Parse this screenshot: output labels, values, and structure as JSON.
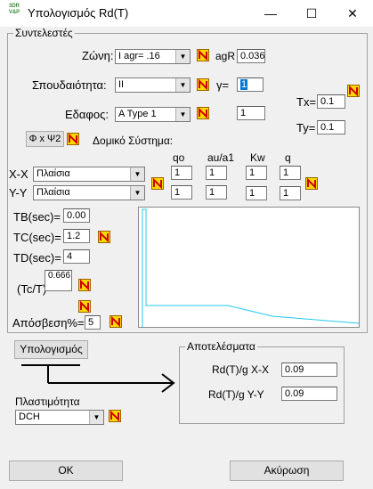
{
  "window": {
    "title": "Υπολογισμός Rd(T)",
    "app_icon_lines": [
      "3DR",
      "V&P"
    ],
    "minimize": "—",
    "maximize": "☐",
    "close": "✕"
  },
  "factors": {
    "legend": "Συντελεστές",
    "zone_label": "Ζώνη:",
    "zone_value": "I    agr= .16",
    "agr_label": "agR",
    "agr_value": "0.036",
    "importance_label": "Σπουδαιότητα:",
    "importance_value": "II",
    "gamma_label": "γ=",
    "gamma_value": "1",
    "soil_label": "Εδαφος:",
    "soil_value": "A Type 1",
    "soil_extra_value": "1",
    "tx_label": "Tx=",
    "tx_value": "0.1",
    "ty_label": "Ty=",
    "ty_value": "0.1",
    "phi_button": "Φ x Ψ2",
    "structural_label": "Δομικό Σύστημα:",
    "col_headers": [
      "qo",
      "au/a1",
      "Kw",
      "q"
    ],
    "xx_label": "X-X",
    "xx_system": "Πλαίσια",
    "xx_values": [
      "1",
      "1",
      "1",
      "1"
    ],
    "yy_label": "Y-Y",
    "yy_system": "Πλαίσια",
    "yy_values": [
      "1",
      "1",
      "1",
      "1"
    ],
    "tb_label": "TB(sec)=",
    "tb_value": "0.00",
    "tc_label": "TC(sec)=",
    "tc_value": "1.2",
    "td_label": "TD(sec)=",
    "td_value": "4",
    "tct_label": "(Tc/T)",
    "tct_value": "0.666",
    "damping_label": "Απόσβεση%=",
    "damping_value": "5"
  },
  "calc_button": "Υπολογισμός",
  "ductility_label": "Πλαστιμότητα",
  "ductility_value": "DCH",
  "results": {
    "legend": "Αποτελέσματα",
    "xx_label": "Rd(T)/g  X-X",
    "xx_value": "0.09",
    "yy_label": "Rd(T)/g  Y-Y",
    "yy_value": "0.09"
  },
  "ok_button": "OK",
  "cancel_button": "Ακύρωση",
  "icon_colors": {
    "note_icon": "#d00000",
    "note_bg": "#ffd800",
    "plot_line": "#22c7f0"
  }
}
